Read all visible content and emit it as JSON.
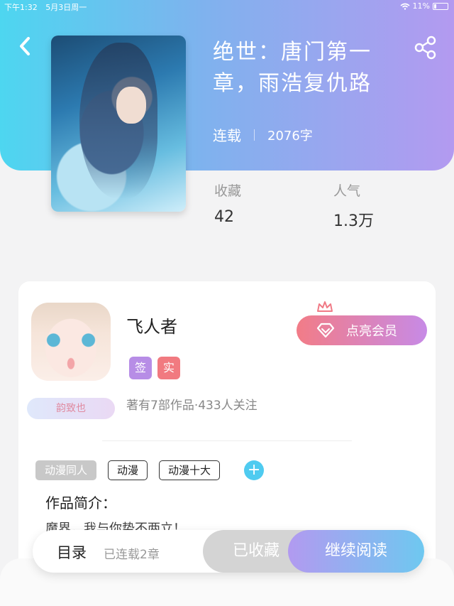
{
  "status_bar": {
    "time": "下午1:32",
    "date": "5月3日周一",
    "battery": "11%"
  },
  "book": {
    "title": "绝世：唐门第一章，雨浩复仇路",
    "status": "连载",
    "word_count": "2076字",
    "stats": [
      {
        "label": "收藏",
        "value": "42"
      },
      {
        "label": "人气",
        "value": "1.3万"
      }
    ]
  },
  "author": {
    "name": "飞人者",
    "badge": "韵致也",
    "tag_sign": "签",
    "tag_real": "实",
    "stats": "著有7部作品·433人关注",
    "vip_label": "点亮会员"
  },
  "tags": [
    "动漫同人",
    "动漫",
    "动漫十大"
  ],
  "intro": {
    "title": "作品简介：",
    "text": "魔界，我与你势不两立！"
  },
  "bottom": {
    "toc_label": "目录",
    "chapters_label": "已连载2章",
    "collected_label": "已收藏",
    "read_label": "继续阅读"
  },
  "colors": {
    "accent_cyan": "#4dd6f0",
    "accent_purple": "#b39af0",
    "vip_pink": "#f27c87"
  }
}
